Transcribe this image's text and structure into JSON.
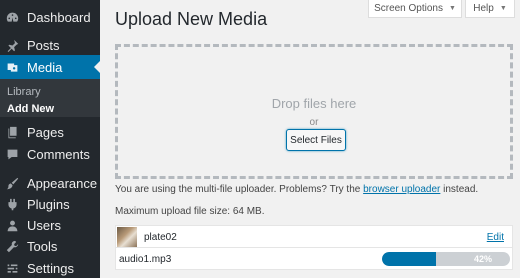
{
  "sidebar": {
    "items": [
      {
        "label": "Dashboard",
        "icon": "dashboard-icon"
      },
      {
        "label": "Posts",
        "icon": "pin-icon"
      },
      {
        "label": "Media",
        "icon": "media-icon",
        "current": true
      },
      {
        "label": "Pages",
        "icon": "pages-icon"
      },
      {
        "label": "Comments",
        "icon": "comments-icon"
      },
      {
        "label": "Appearance",
        "icon": "brush-icon"
      },
      {
        "label": "Plugins",
        "icon": "plugin-icon"
      },
      {
        "label": "Users",
        "icon": "users-icon"
      },
      {
        "label": "Tools",
        "icon": "wrench-icon"
      },
      {
        "label": "Settings",
        "icon": "settings-icon"
      }
    ],
    "submenu": {
      "library": "Library",
      "add_new": "Add New"
    }
  },
  "header": {
    "screen_options": "Screen Options",
    "help": "Help",
    "title": "Upload New Media"
  },
  "dropzone": {
    "drop_text": "Drop files here",
    "or_text": "or",
    "select_files": "Select Files"
  },
  "info": {
    "prefix": "You are using the multi-file uploader. Problems? Try the ",
    "link": "browser uploader",
    "suffix": " instead.",
    "max_upload": "Maximum upload file size: 64 MB."
  },
  "media_items": [
    {
      "name": "plate02",
      "action": "Edit"
    },
    {
      "name": "audio1.mp3",
      "progress_percent": 42,
      "progress_label": "42%"
    }
  ],
  "colors": {
    "sidebar_bg": "#23282d",
    "accent": "#0073aa",
    "page_bg": "#f1f1f1"
  }
}
